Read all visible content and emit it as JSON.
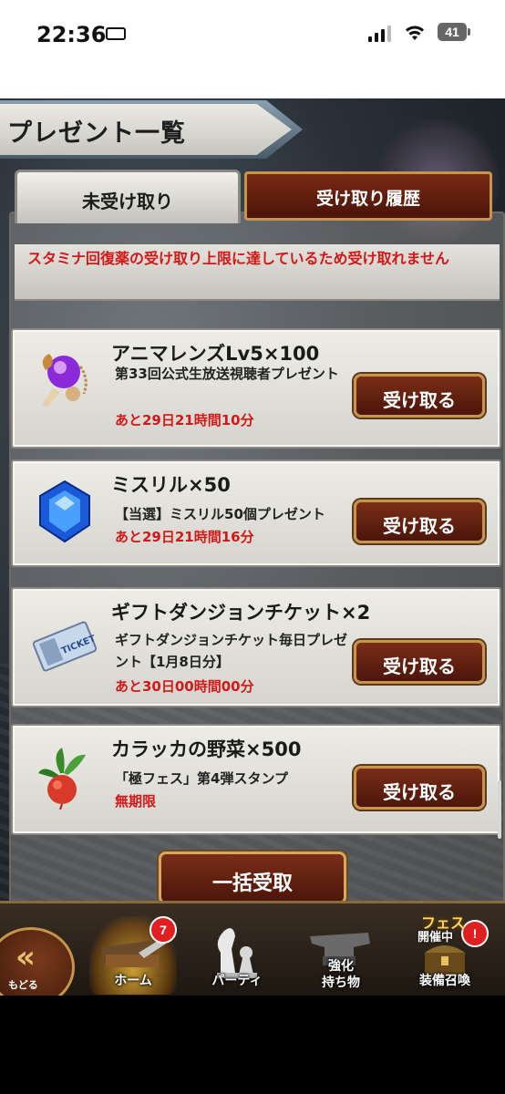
{
  "status_bar": {
    "time": "22:36",
    "battery": "41"
  },
  "screen": {
    "title": "プレゼント一覧"
  },
  "tabs": {
    "active": "未受け取り",
    "inactive": "受け取り履歴"
  },
  "notice": "スタミナ回復薬の受け取り上限に達しているため受け取れません",
  "items": [
    {
      "name": "アニマレンズLv5×100",
      "desc": "第33回公式生放送視聴者プレゼント",
      "time": "あと29日21時間10分",
      "button": "受け取る",
      "icon": "anima-lens-icon"
    },
    {
      "name": "ミスリル×50",
      "desc": "【当選】ミスリル50個プレゼント",
      "time": "あと29日21時間16分",
      "button": "受け取る",
      "icon": "mythril-icon"
    },
    {
      "name": "ギフトダンジョンチケット×2",
      "desc": "ギフトダンジョンチケット毎日プレゼント【1月8日分】",
      "time": "あと30日00時間00分",
      "button": "受け取る",
      "icon": "ticket-icon"
    },
    {
      "name": "カラッカの野菜×500",
      "desc": "「極フェス」第4弾スタンプ",
      "time": "無期限",
      "button": "受け取る",
      "icon": "vegetable-icon"
    }
  ],
  "bulk_button": "一括受取",
  "nav": {
    "back": "もどる",
    "home": "ホーム",
    "home_badge": "7",
    "party": "パーティ",
    "enhance_line1": "強化",
    "enhance_line2": "持ち物",
    "summon": "装備召喚",
    "summon_badge": "!",
    "fes_line1": "フェス",
    "fes_line2": "開催中"
  },
  "colors": {
    "accent_red": "#d41818",
    "button_brown": "#5a1a0c",
    "gold_border": "#c8944a"
  }
}
